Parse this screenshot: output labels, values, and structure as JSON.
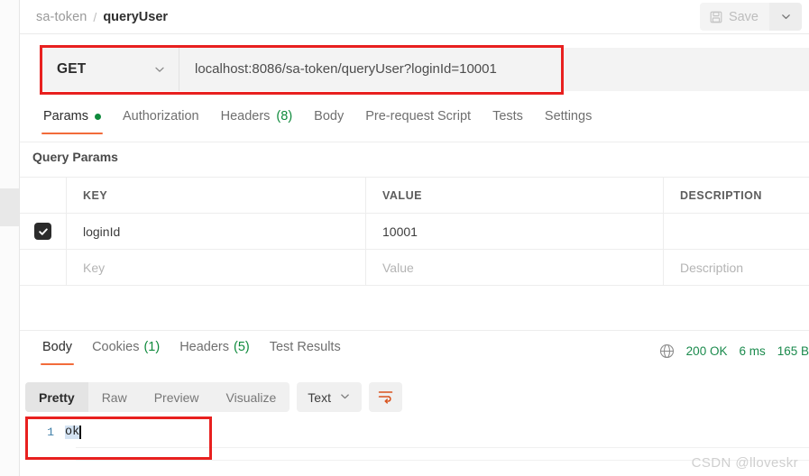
{
  "breadcrumb": {
    "collection": "sa-token",
    "separator": "/",
    "request_name": "queryUser"
  },
  "toolbar": {
    "save_label": "Save",
    "save_icon": "floppy-disk-icon",
    "save_dropdown_icon": "chevron-down-icon",
    "save_disabled": true
  },
  "url_bar": {
    "method": "GET",
    "method_dropdown_icon": "chevron-down-icon",
    "url": "localhost:8086/sa-token/queryUser?loginId=10001"
  },
  "request_tabs": [
    {
      "label": "Params",
      "indicator": "dot",
      "active": true
    },
    {
      "label": "Authorization",
      "active": false
    },
    {
      "label": "Headers",
      "count": "(8)",
      "active": false
    },
    {
      "label": "Body",
      "active": false
    },
    {
      "label": "Pre-request Script",
      "active": false
    },
    {
      "label": "Tests",
      "active": false
    },
    {
      "label": "Settings",
      "active": false
    }
  ],
  "query_params": {
    "section_title": "Query Params",
    "columns": [
      "KEY",
      "VALUE",
      "DESCRIPTION"
    ],
    "rows": [
      {
        "checked": true,
        "key": "loginId",
        "value": "10001",
        "description": ""
      },
      {
        "checked": false,
        "key": "Key",
        "value": "Value",
        "description": "Description",
        "placeholder": true
      }
    ]
  },
  "response_tabs": [
    {
      "label": "Body",
      "active": true
    },
    {
      "label": "Cookies",
      "count": "(1)",
      "active": false
    },
    {
      "label": "Headers",
      "count": "(5)",
      "active": false
    },
    {
      "label": "Test Results",
      "active": false
    }
  ],
  "response_status": {
    "globe_icon": "globe-icon",
    "status": "200 OK",
    "time": "6 ms",
    "size": "165 B"
  },
  "body_toolbar": {
    "views": [
      {
        "label": "Pretty",
        "active": true
      },
      {
        "label": "Raw",
        "active": false
      },
      {
        "label": "Preview",
        "active": false
      },
      {
        "label": "Visualize",
        "active": false
      }
    ],
    "format": "Text",
    "format_dropdown_icon": "chevron-down-icon",
    "wrap_icon": "word-wrap-icon"
  },
  "response_body": {
    "line_number": "1",
    "content": "ok"
  },
  "watermark": "CSDN @lloveskr",
  "colors": {
    "accent_orange": "#f26b3a",
    "success_green": "#1a8a4c",
    "annotation_red": "#e8201f",
    "selection_blue": "#d4e3f3"
  }
}
